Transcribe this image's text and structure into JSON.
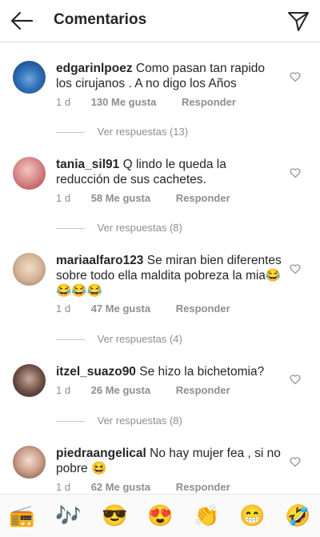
{
  "header": {
    "title": "Comentarios"
  },
  "comments": [
    {
      "username": "edgarinlpoez",
      "text": "Como pasan tan rapido los cirujanos . A no digo los Años",
      "time": "1 d",
      "likes": "130 Me gusta",
      "reply": "Responder",
      "view_replies": "Ver respuestas (13)"
    },
    {
      "username": "tania_sil91",
      "text": "Q lindo le queda la reducción de sus cachetes.",
      "time": "1 d",
      "likes": "58 Me gusta",
      "reply": "Responder",
      "view_replies": "Ver respuestas (8)"
    },
    {
      "username": "mariaalfaro123",
      "text": "Se miran bien diferentes sobre todo ella maldita pobreza la mia😂😂😂😂",
      "time": "1 d",
      "likes": "47 Me gusta",
      "reply": "Responder",
      "view_replies": "Ver respuestas (4)"
    },
    {
      "username": "itzel_suazo90",
      "text": "Se hizo la bichetomia?",
      "time": "1 d",
      "likes": "26 Me gusta",
      "reply": "Responder",
      "view_replies": "Ver respuestas (8)"
    },
    {
      "username": "piedraangelical",
      "text": "No hay mujer fea , si no pobre 😆",
      "time": "1 d",
      "likes": "62 Me gusta",
      "reply": "Responder"
    }
  ],
  "emoji_bar": [
    "📻",
    "🎶",
    "😎",
    "😍",
    "👏",
    "😁",
    "🤣"
  ],
  "colors": {
    "text": "#262626",
    "meta": "#8e8e8e",
    "divider": "#dbdbdb"
  },
  "icons": [
    "back-arrow-icon",
    "direct-message-icon",
    "heart-icon"
  ]
}
